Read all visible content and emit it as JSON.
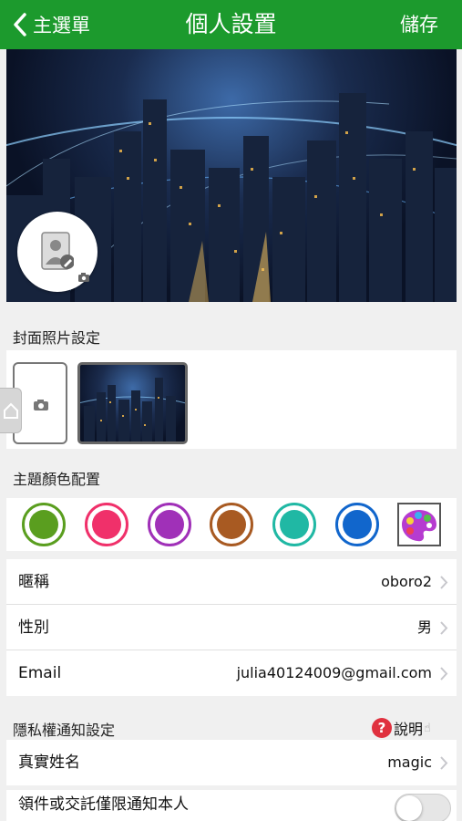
{
  "header": {
    "back_label": "主選單",
    "title": "個人設置",
    "save_label": "儲存"
  },
  "cover_settings": {
    "label": "封面照片設定"
  },
  "theme": {
    "label": "主題顏色配置",
    "colors": [
      "#5a9e1f",
      "#f0306a",
      "#a030b8",
      "#a85a22",
      "#20b8a4",
      "#1166cc"
    ]
  },
  "profile": {
    "nickname": {
      "label": "暱稱",
      "value": "oboro2"
    },
    "gender": {
      "label": "性別",
      "value": "男"
    },
    "email": {
      "label": "Email",
      "value": "julia40124009@gmail.com"
    }
  },
  "privacy": {
    "label": "隱私權通知設定",
    "help_label": "說明",
    "real_name": {
      "label": "真實姓名",
      "value": "magic"
    },
    "notify_self": {
      "label": "領件或交託僅限通知本人",
      "enabled": false
    }
  }
}
